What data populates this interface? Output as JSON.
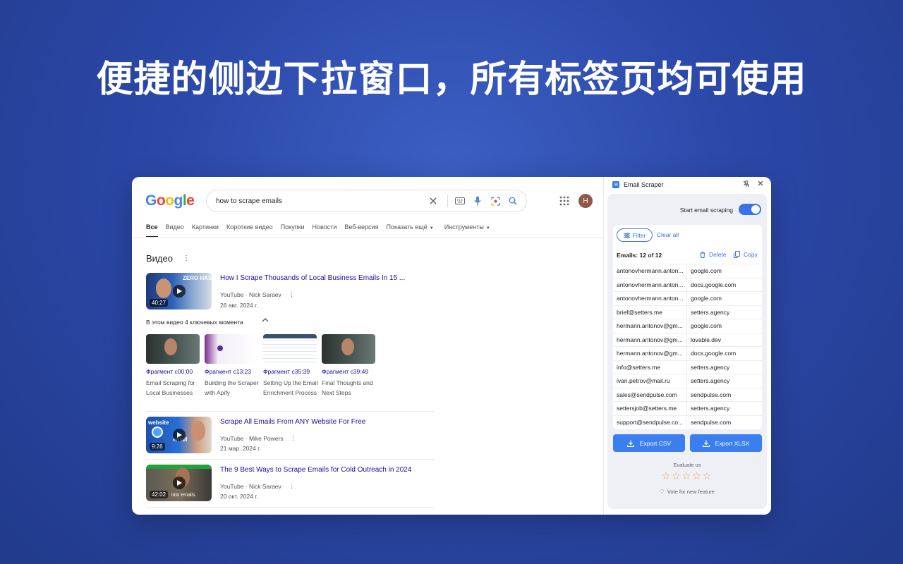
{
  "headline": "便捷的侧边下拉窗口，所有标签页均可使用",
  "google": {
    "logo_letters": [
      "G",
      "o",
      "o",
      "g",
      "l",
      "e"
    ],
    "search_query": "how to scrape emails",
    "avatar_letter": "H",
    "tabs": [
      "Все",
      "Видео",
      "Картинки",
      "Короткие видео",
      "Покупки",
      "Новости",
      "Веб-версия",
      "Показать ещё",
      "Инструменты"
    ],
    "section_title": "Видео",
    "videos": [
      {
        "title": "How I Scrape Thousands of Local Business Emails In 15 ...",
        "meta": "YouTube · Nick Saraev",
        "date": "26 авг. 2024 г.",
        "duration": "40:27",
        "thumb_text": "ZERO HASSLE"
      },
      {
        "title": "Scrape All Emails From ANY Website For Free",
        "meta": "YouTube · Mike Powers",
        "date": "21 мар. 2024 г.",
        "duration": "9:26",
        "thumb_text_1": "website",
        "thumb_text_2": "email"
      },
      {
        "title": "The 9 Best Ways to Scrape Emails for Cold Outreach in 2024",
        "meta": "YouTube · Nick Saraev",
        "date": "20 окт. 2024 г.",
        "duration": "42:02",
        "thumb_text": "into emails."
      }
    ],
    "key_moments_label": "В этом видео 4 ключевых момента",
    "fragments": [
      {
        "label": "Фрагмент с00:00",
        "desc": "Email Scraping for Local Businesses"
      },
      {
        "label": "Фрагмент с13:23",
        "desc": "Building the Scraper with Apify"
      },
      {
        "label": "Фрагмент с35:39",
        "desc": "Setting Up the Email Enrichment Process"
      },
      {
        "label": "Фрагмент с39:49",
        "desc": "Final Thoughts and Next Steps"
      }
    ]
  },
  "extension": {
    "title": "Email Scraper",
    "toggle_label": "Start email scraping",
    "toggle_on": true,
    "filter_label": "Filter",
    "clear_all_label": "Clear all",
    "count_label": "Emails: 12 of 12",
    "delete_label": "Delete",
    "copy_label": "Copy",
    "emails": [
      {
        "email": "antonovhermann.anton...",
        "domain": "google.com"
      },
      {
        "email": "antonovhermann.anton...",
        "domain": "docs.google.com"
      },
      {
        "email": "antonovhermann.anton...",
        "domain": "google.com"
      },
      {
        "email": "brief@setters.me",
        "domain": "setters.agency"
      },
      {
        "email": "hermann.antonov@gm...",
        "domain": "google.com"
      },
      {
        "email": "hermann.antonov@gm...",
        "domain": "lovable.dev"
      },
      {
        "email": "hermann.antonov@gm...",
        "domain": "docs.google.com"
      },
      {
        "email": "info@setters.me",
        "domain": "setters.agency"
      },
      {
        "email": "ivan.petrov@mail.ru",
        "domain": "setters.agency"
      },
      {
        "email": "sales@sendpulse.com",
        "domain": "sendpulse.com"
      },
      {
        "email": "settersjob@setters.me",
        "domain": "setters.agency"
      },
      {
        "email": "support@sendpulse.co...",
        "domain": "sendpulse.com"
      }
    ],
    "export_csv_label": "Export CSV",
    "export_xlsx_label": "Export XLSX",
    "evaluate_label": "Evaluate us",
    "stars": "☆☆☆☆☆",
    "vote_label": "Vote for new feature",
    "accent_color": "#3b73e6"
  }
}
